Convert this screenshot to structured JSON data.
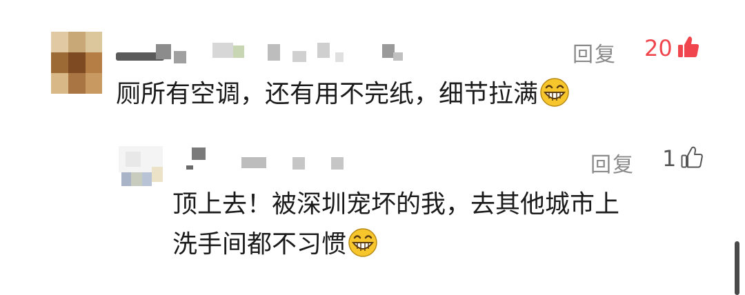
{
  "comments": [
    {
      "text": "厕所有空调，还有用不完纸，细节拉满",
      "reply_label": "回复",
      "like_count": "20",
      "liked": true,
      "emoji": "grinning-emoji"
    },
    {
      "text_line1": "顶上去！被深圳宠坏的我，去其他城市上",
      "text_line2": "洗手间都不习惯",
      "reply_label": "回复",
      "like_count": "1",
      "liked": false,
      "emoji": "grinning-emoji"
    }
  ],
  "colors": {
    "like_active": "#f0454c",
    "like_inactive": "#555555",
    "secondary_text": "#8a8a8a",
    "primary_text": "#1a1a1a"
  },
  "icons": [
    "thumbs-up-filled-icon",
    "thumbs-up-outline-icon",
    "grinning-emoji"
  ]
}
